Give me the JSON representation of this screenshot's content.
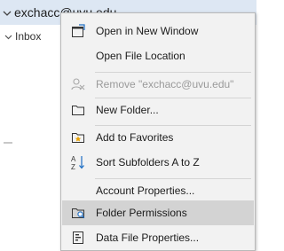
{
  "nav": {
    "account": "exchacc@uvu.edu",
    "inbox": "Inbox"
  },
  "menu": {
    "items": [
      {
        "label": "Open in New Window",
        "icon": "new-window-icon"
      },
      {
        "label": "Open File Location",
        "icon": ""
      },
      {
        "label": "Remove \"exchacc@uvu.edu\"",
        "icon": "remove-account-icon",
        "disabled": true
      },
      {
        "label": "New Folder...",
        "icon": "new-folder-icon"
      },
      {
        "label": "Add to Favorites",
        "icon": "favorites-star-icon"
      },
      {
        "label": "Sort Subfolders A to Z",
        "icon": "sort-az-icon"
      },
      {
        "label": "Account Properties...",
        "icon": ""
      },
      {
        "label": "Folder Permissions",
        "icon": "folder-permissions-icon",
        "highlighted": true
      },
      {
        "label": "Data File Properties...",
        "icon": "data-file-icon"
      }
    ]
  },
  "colors": {
    "accent": "#1f6fc5",
    "highlight": "#d3d3d3",
    "menu_bg": "#f2f2f2",
    "nav_selected": "#dde7f3"
  }
}
